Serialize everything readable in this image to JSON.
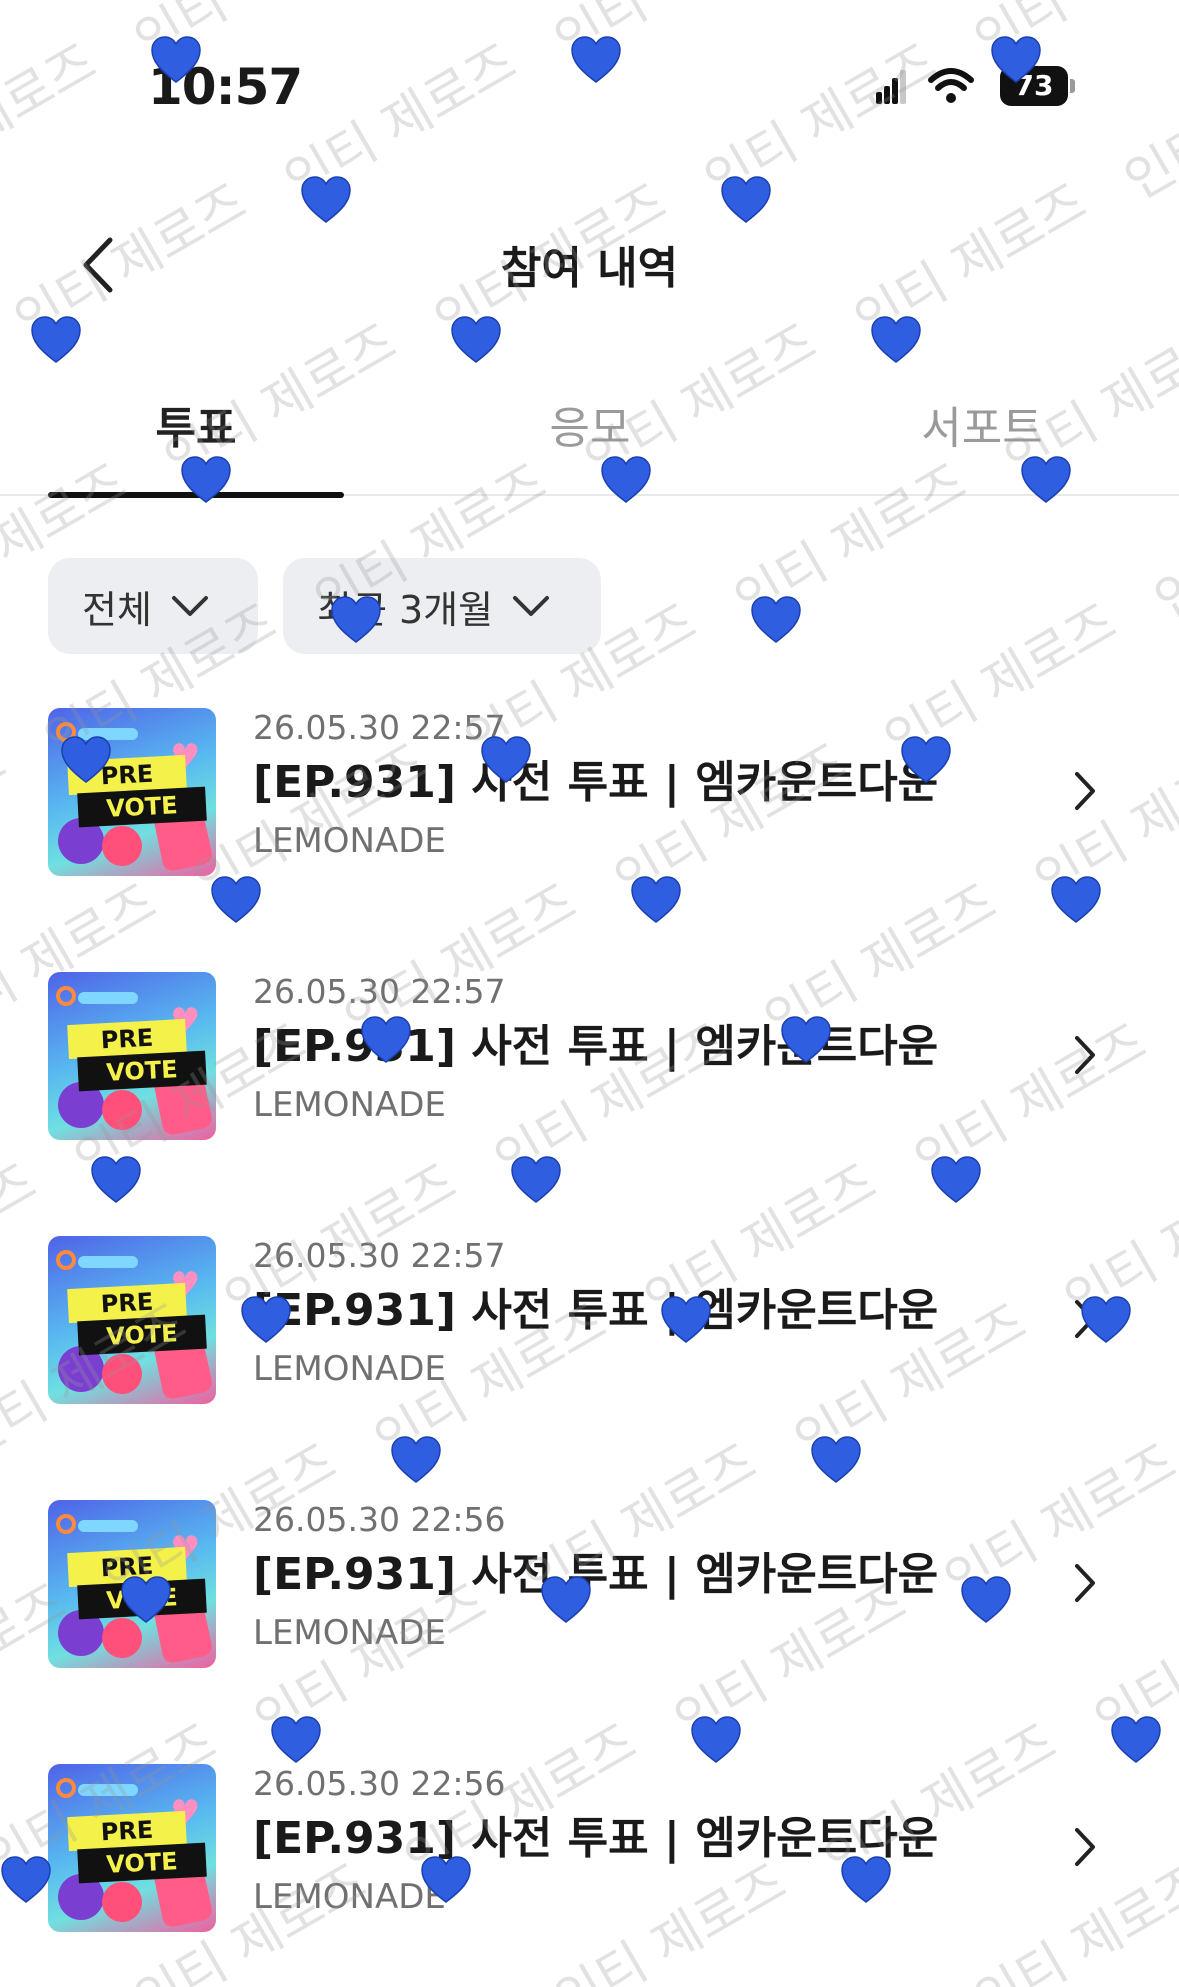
{
  "status_bar": {
    "time": "10:57",
    "battery": "73"
  },
  "header": {
    "title": "참여 내역",
    "back_icon": "chevron-left-icon"
  },
  "tabs": [
    {
      "label": "투표",
      "active": true
    },
    {
      "label": "응모",
      "active": false
    },
    {
      "label": "서포트",
      "active": false
    }
  ],
  "filters": [
    {
      "label": "전체",
      "icon": "chevron-down-icon"
    },
    {
      "label": "최근 3개월",
      "icon": "chevron-down-icon"
    }
  ],
  "items": [
    {
      "date": "26.05.30 22:57",
      "title": "[EP.931] 사전 투표 | 엠카운트다운",
      "artist": "LEMONADE",
      "thumb_pre": "PRE",
      "thumb_vote": "VOTE"
    },
    {
      "date": "26.05.30 22:57",
      "title": "[EP.931] 사전 투표 | 엠카운트다운",
      "artist": "LEMONADE",
      "thumb_pre": "PRE",
      "thumb_vote": "VOTE"
    },
    {
      "date": "26.05.30 22:57",
      "title": "[EP.931] 사전 투표 | 엠카운트다운",
      "artist": "LEMONADE",
      "thumb_pre": "PRE",
      "thumb_vote": "VOTE"
    },
    {
      "date": "26.05.30 22:56",
      "title": "[EP.931] 사전 투표 | 엠카운트다운",
      "artist": "LEMONADE",
      "thumb_pre": "PRE",
      "thumb_vote": "VOTE"
    },
    {
      "date": "26.05.30 22:56",
      "title": "[EP.931] 사전 투표 | 엠카운트다운",
      "artist": "LEMONADE",
      "thumb_pre": "PRE",
      "thumb_vote": "VOTE"
    }
  ],
  "watermark": {
    "text": "인티 제로즈",
    "heart_color": "#2f5fe0"
  },
  "colors": {
    "accent": "#111111",
    "chip_bg": "#eceef2",
    "muted_text": "#707070"
  }
}
